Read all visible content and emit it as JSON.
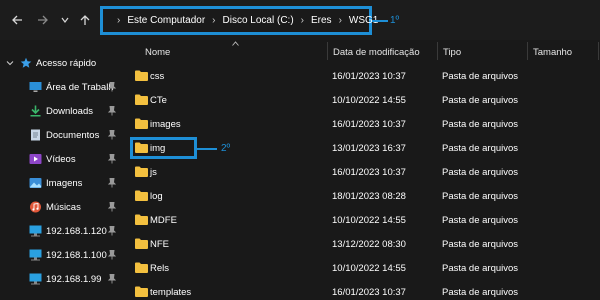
{
  "navigation": {
    "back_icon": "arrow-left-icon",
    "forward_icon": "arrow-right-icon",
    "history_icon": "chevron-down-icon",
    "up_icon": "arrow-up-icon"
  },
  "address_bar": {
    "breadcrumbs": [
      "Este Computador",
      "Disco Local (C:)",
      "Eres",
      "WSG1"
    ],
    "separator": "›"
  },
  "annotations": {
    "label_1": "1º",
    "label_2": "2º",
    "color": "#1e8fd6"
  },
  "sidebar": {
    "quick_access": {
      "label": "Acesso rápido",
      "icon": "star-icon"
    },
    "items": [
      {
        "label": "Área de Trabalh",
        "icon": "desktop-icon",
        "pinned": true
      },
      {
        "label": "Downloads",
        "icon": "download-icon",
        "pinned": true
      },
      {
        "label": "Documentos",
        "icon": "document-icon",
        "pinned": true
      },
      {
        "label": "Vídeos",
        "icon": "video-icon",
        "pinned": true
      },
      {
        "label": "Imagens",
        "icon": "image-icon",
        "pinned": true
      },
      {
        "label": "Músicas",
        "icon": "music-icon",
        "pinned": true
      },
      {
        "label": "192.168.1.120",
        "icon": "network-drive-icon",
        "pinned": true
      },
      {
        "label": "192.168.1.100",
        "icon": "network-drive-icon",
        "pinned": true
      },
      {
        "label": "192.168.1.99",
        "icon": "network-drive-icon",
        "pinned": true
      }
    ]
  },
  "columns": {
    "name": "Nome",
    "date": "Data de modificação",
    "type": "Tipo",
    "size": "Tamanho"
  },
  "files": [
    {
      "name": "css",
      "date": "16/01/2023 10:37",
      "type": "Pasta de arquivos"
    },
    {
      "name": "CTe",
      "date": "10/10/2022 14:55",
      "type": "Pasta de arquivos"
    },
    {
      "name": "images",
      "date": "16/01/2023 10:37",
      "type": "Pasta de arquivos"
    },
    {
      "name": "img",
      "date": "13/01/2023 16:37",
      "type": "Pasta de arquivos"
    },
    {
      "name": "js",
      "date": "16/01/2023 10:37",
      "type": "Pasta de arquivos"
    },
    {
      "name": "log",
      "date": "18/01/2023 08:28",
      "type": "Pasta de arquivos"
    },
    {
      "name": "MDFE",
      "date": "10/10/2022 14:55",
      "type": "Pasta de arquivos"
    },
    {
      "name": "NFE",
      "date": "13/12/2022 08:30",
      "type": "Pasta de arquivos"
    },
    {
      "name": "Rels",
      "date": "10/10/2022 14:55",
      "type": "Pasta de arquivos"
    },
    {
      "name": "templates",
      "date": "16/01/2023 10:37",
      "type": "Pasta de arquivos"
    }
  ],
  "colors": {
    "background": "#191919",
    "folder": "#f3c03f",
    "accent": "#1e8fd6"
  }
}
